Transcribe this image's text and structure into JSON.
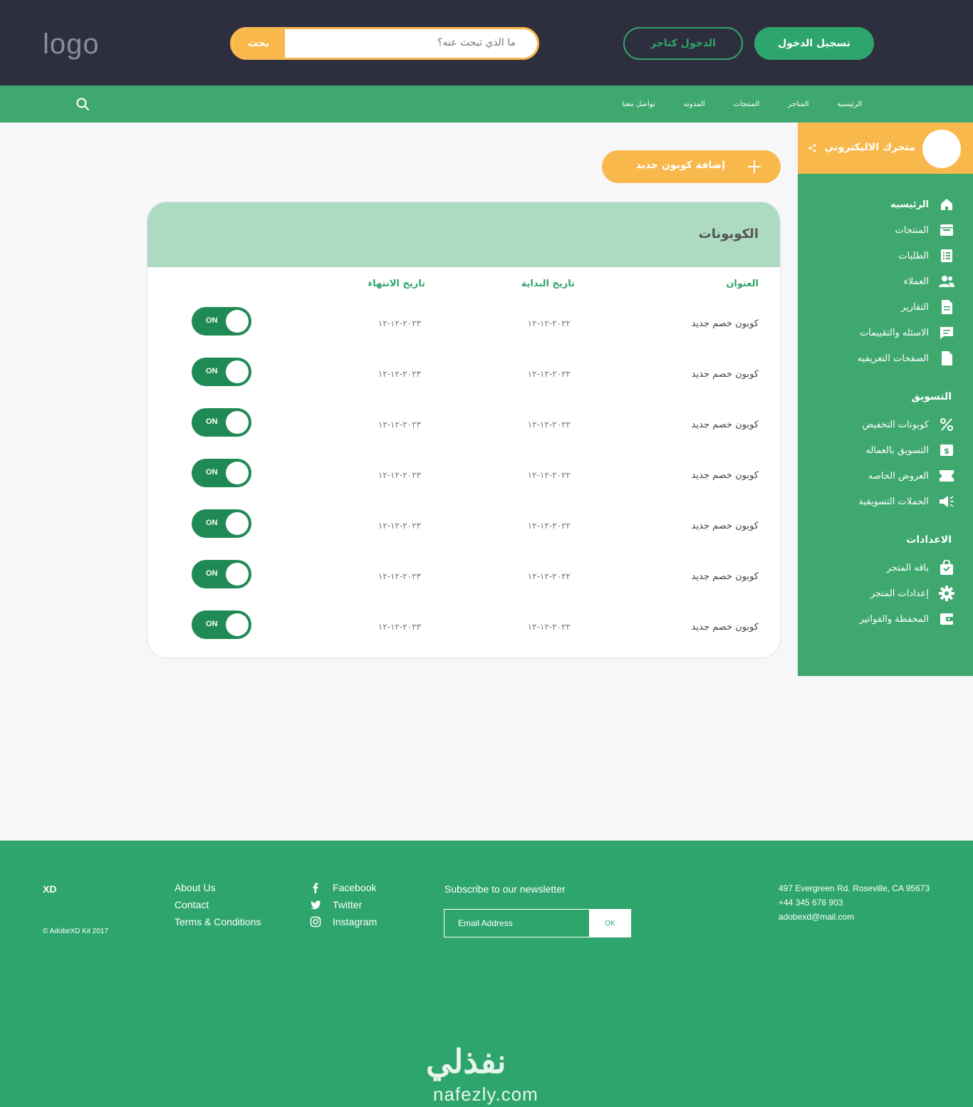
{
  "header": {
    "logo": "logo",
    "search_placeholder": "ما الذي تبحث عنه؟",
    "search_button": "بحث",
    "merchant_login": "الدخول كتاجر",
    "login": "تسجيل الدخول"
  },
  "nav": {
    "items": [
      "الرئيسية",
      "المتاجر",
      "المنتجات",
      "المدونه",
      "تواصل معنا"
    ]
  },
  "sidebar": {
    "store_name": "متجرك الاليكتروني",
    "main_items": [
      {
        "label": "الرئيسيه",
        "icon": "home-icon"
      },
      {
        "label": "المنتجات",
        "icon": "archive-icon"
      },
      {
        "label": "الطلبات",
        "icon": "list-icon"
      },
      {
        "label": "العملاء",
        "icon": "users-icon"
      },
      {
        "label": "التقارير",
        "icon": "report-icon"
      },
      {
        "label": "الاسئله والتقييمات",
        "icon": "comment-icon"
      },
      {
        "label": "الصفحات التعريفيه",
        "icon": "page-icon"
      }
    ],
    "marketing_title": "التسويق",
    "marketing_items": [
      {
        "label": "كوبونات التخفيض",
        "icon": "percent-icon"
      },
      {
        "label": "التسويق بالعماله",
        "icon": "dollar-icon"
      },
      {
        "label": "العروض الخاصه",
        "icon": "ticket-icon"
      },
      {
        "label": "الحملات التسويقية",
        "icon": "megaphone-icon"
      }
    ],
    "settings_title": "الاعدادات",
    "settings_items": [
      {
        "label": "باقه المتجر",
        "icon": "bag-icon"
      },
      {
        "label": "إعدادات المتجر",
        "icon": "gear-icon"
      },
      {
        "label": "المحفظة والفواتير",
        "icon": "wallet-icon"
      }
    ]
  },
  "add_coupon": "إضافة كوبون جديد",
  "coupons": {
    "title": "الكوبونات",
    "columns": [
      "العنوان",
      "تاريخ البداية",
      "تاريخ الانتهاء"
    ],
    "toggle_label": "ON",
    "rows": [
      {
        "title": "كوبون خصم جديد",
        "start": "٢٠٢٢-١٢-١٢",
        "end": "٢٠٢٣-١٢-١٢",
        "enabled": true
      },
      {
        "title": "كوبون خصم جديد",
        "start": "٢٠٢٢-١٢-١٢",
        "end": "٢٠٢٣-١٢-١٢",
        "enabled": true
      },
      {
        "title": "كوبون خصم جديد",
        "start": "٢٠٢٢-١٢-١٢",
        "end": "٢٠٢٣-١٢-١٢",
        "enabled": true
      },
      {
        "title": "كوبون خصم جديد",
        "start": "٢٠٢٢-١٢-١٢",
        "end": "٢٠٢٣-١٢-١٢",
        "enabled": true
      },
      {
        "title": "كوبون خصم جديد",
        "start": "٢٠٢٢-١٢-١٢",
        "end": "٢٠٢٣-١٢-١٢",
        "enabled": true
      },
      {
        "title": "كوبون خصم جديد",
        "start": "٢٠٢٢-١٢-١٢",
        "end": "٢٠٢٣-١٢-١٢",
        "enabled": true
      },
      {
        "title": "كوبون خصم جديد",
        "start": "٢٠٢٢-١٢-١٢",
        "end": "٢٠٢٣-١٢-١٢",
        "enabled": true
      }
    ]
  },
  "footer": {
    "brand": "XD",
    "copyright": "© AdobeXD Kit 2017",
    "links": [
      "About Us",
      "Contact",
      "Terms & Conditions"
    ],
    "social": [
      {
        "label": "Facebook",
        "icon": "facebook-icon"
      },
      {
        "label": "Twitter",
        "icon": "twitter-icon"
      },
      {
        "label": "Instagram",
        "icon": "instagram-icon"
      }
    ],
    "newsletter_title": "Subscribe to our newsletter",
    "email_placeholder": "Email Address",
    "ok_label": "OK",
    "address": [
      "497 Evergreen Rd. Roseville, CA 95673",
      "+44 345 678 903",
      "adobexd@mail.com"
    ],
    "watermark_ar": "نفذلي",
    "watermark_en": "nafezly.com"
  },
  "colors": {
    "dark": "#2e2f3e",
    "green": "#3fa86f",
    "deep_green": "#1f8a55",
    "orange": "#f8b84c",
    "light_green": "#acdbc2"
  }
}
